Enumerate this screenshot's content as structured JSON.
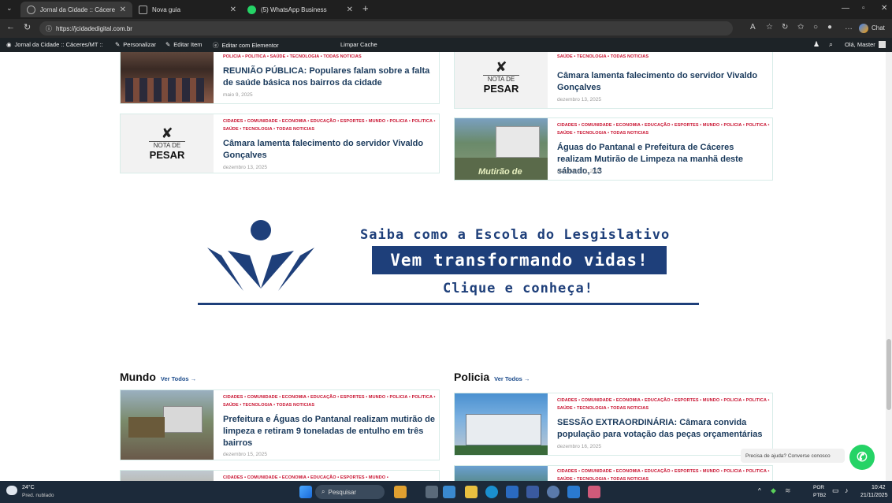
{
  "browser": {
    "tabs": [
      {
        "label": "Jornal da Cidade :: Cáceres/MT ::"
      },
      {
        "label": "Nova guia"
      },
      {
        "label": "(5) WhatsApp Business"
      }
    ],
    "new_tab": "+",
    "url": "https://jcidadedigital.com.br",
    "chat_label": "Chat"
  },
  "wp_admin": {
    "site": "Jornal da Cidade :: Cáceres/MT ::",
    "customize": "Personalizar",
    "edit_item": "Editar Item",
    "elementor": "Editar com Elementor",
    "clear_cache": "Limpar Cache",
    "greeting": "Olá, Master"
  },
  "cards": [
    {
      "cats": "POLICIA  •  POLITICA  •  SAÚDE  •  TECNOLOGIA  •  TODAS NOTICIAS",
      "title": "REUNIÃO PÚBLICA: Populares falam sobre a falta de saúde básica nos bairros da cidade",
      "date": "maio 9, 2025"
    },
    {
      "cats": "POLICIA  •  POLITICA  •  SAÚDE  •  TECNOLOGIA  •  TODAS NOTICIAS",
      "title": "Câmara lamenta falecimento do servidor Vivaldo Gonçalves",
      "date": "dezembro 13, 2025"
    },
    {
      "cats": "CIDADES  •  COMUNIDADE  •  ECONOMIA  •  EDUCAÇÃO  •  ESPORTES  •  MUNDO  •  POLICIA  •  POLITICA  •  SAÚDE  •  TECNOLOGIA  •  TODAS NOTICIAS",
      "title": "Câmara lamenta falecimento do servidor Vivaldo Gonçalves",
      "date": "dezembro 13, 2025"
    },
    {
      "cats": "CIDADES  •  COMUNIDADE  •  ECONOMIA  •  EDUCAÇÃO  •  ESPORTES  •  MUNDO  •  POLICIA  •  POLITICA  •  SAÚDE  •  TECNOLOGIA  •  TODAS NOTICIAS",
      "title": "Águas do Pantanal e Prefeitura de Cáceres realizam Mutirão de Limpeza na manhã deste sábado, 13",
      "date": "dezembro 13, 2025"
    },
    {
      "cats": "CIDADES  •  COMUNIDADE  •  ECONOMIA  •  EDUCAÇÃO  •  ESPORTES  •  MUNDO  •  POLICIA  •  POLITICA  •  SAÚDE  •  TECNOLOGIA  •  TODAS NOTICIAS",
      "title": "Prefeitura e Águas do Pantanal realizam mutirão de limpeza e retiram 9 toneladas de entulho em três bairros",
      "date": "dezembro 15, 2025"
    },
    {
      "cats": "CIDADES  •  COMUNIDADE  •  ECONOMIA  •  EDUCAÇÃO  •  ESPORTES  •  MUNDO  •  POLICIA  •  POLITICA  •  SAÚDE  •  TECNOLOGIA  •  TODAS NOTICIAS",
      "title": "SESSÃO EXTRAORDINÁRIA: Câmara convida população para votação das peças orçamentárias",
      "date": "dezembro 16, 2025"
    },
    {
      "cats": "CIDADES  •  COMUNIDADE  •  ECONOMIA  •  EDUCAÇÃO  •  ESPORTES  •  MUNDO  •"
    },
    {
      "cats": "CIDADES  •  COMUNIDADE  •  ECONOMIA  •  EDUCAÇÃO  •  ESPORTES  •  MUNDO  •  POLICIA  •  POLITICA  •  SAÚDE  •  TECNOLOGIA  •  TODAS NOTICIAS"
    }
  ],
  "pesar": {
    "nota_de": "NOTA DE",
    "pesar": "PESAR"
  },
  "thumb_text": "Mutirão de",
  "sections": {
    "mundo": {
      "title": "Mundo",
      "link": "Ver Todos →"
    },
    "policia": {
      "title": "Policia",
      "link": "Ver Todos →"
    }
  },
  "banner": {
    "line1": "Saiba como a Escola do Lesgislativo",
    "line2": "Vem transformando vidas!",
    "line3": "Clique e conheça!"
  },
  "whatsapp": {
    "prompt": "Precisa de ajuda? Converse conosco"
  },
  "taskbar": {
    "temp": "24°C",
    "weather": "Pred. nublado",
    "search": "Pesquisar",
    "lang1": "POR",
    "lang2": "PTB2",
    "time": "10:42",
    "date": "21/11/2025"
  },
  "colors": {
    "accent_red": "#c8102e",
    "title_blue": "#1a3a5c",
    "banner_blue": "#1e3f7a",
    "whatsapp": "#25d366"
  }
}
